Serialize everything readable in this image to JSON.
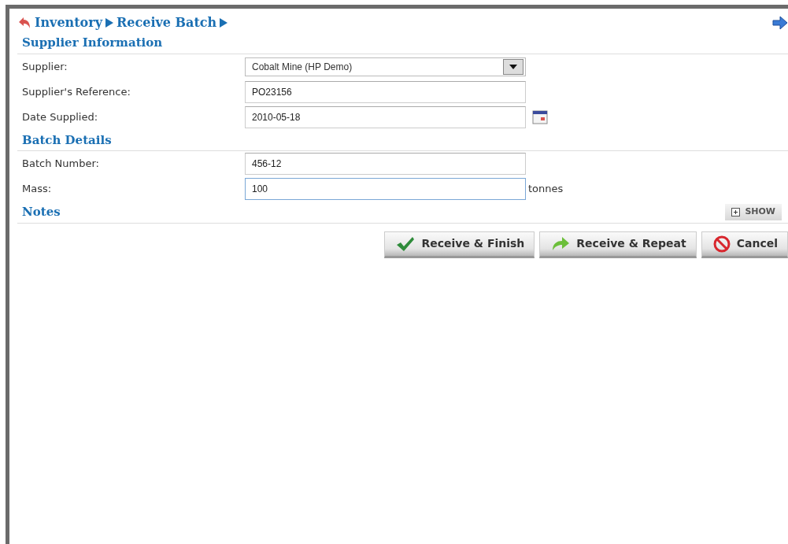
{
  "breadcrumb": [
    "Inventory",
    "Receive Batch"
  ],
  "sections": [
    {
      "title": "Supplier Information",
      "fields": [
        {
          "label": "Supplier:",
          "kind": "select",
          "value": "Cobalt Mine (HP Demo)",
          "focused": false
        },
        {
          "label": "Supplier's Reference:",
          "kind": "text",
          "value": "PO23156",
          "focused": false
        },
        {
          "label": "Date Supplied:",
          "kind": "date",
          "value": "2010-05-18",
          "focused": false
        }
      ]
    },
    {
      "title": "Batch Details",
      "fields": [
        {
          "label": "Batch Number:",
          "kind": "text",
          "value": "456-12",
          "focused": false
        },
        {
          "label": "Mass:",
          "kind": "unit",
          "value": "100",
          "unit": "tonnes",
          "focused": true
        }
      ]
    },
    {
      "title": "Notes",
      "toggle": "SHOW"
    }
  ],
  "buttons": [
    {
      "label": "Receive & Finish",
      "kind": "finish"
    },
    {
      "label": "Receive & Repeat",
      "kind": "repeat"
    },
    {
      "label": "Cancel",
      "kind": "cancel"
    }
  ]
}
